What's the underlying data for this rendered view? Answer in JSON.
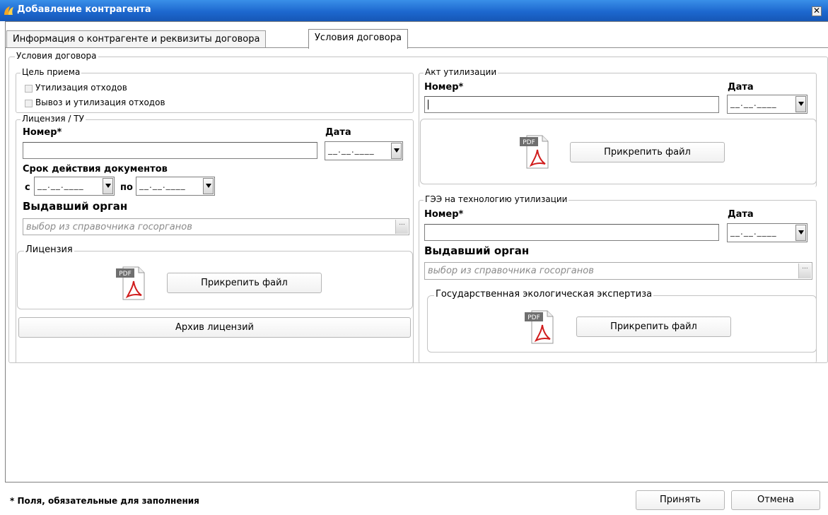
{
  "window": {
    "title": "Добавление контрагента",
    "close_glyph": "✕",
    "icon": "app-logo-icon"
  },
  "tabs": [
    {
      "label": "Информация о контрагенте и реквизиты договора",
      "active": false
    },
    {
      "label": "Условия договора",
      "active": true
    }
  ],
  "conditions": {
    "label": "Условия договора"
  },
  "purpose": {
    "label": "Цель приема",
    "options": [
      {
        "label": "Утилизация отходов",
        "checked": false
      },
      {
        "label": "Вывоз и утилизация отходов",
        "checked": false
      }
    ]
  },
  "license": {
    "label": "Лицензия / ТУ",
    "number_label": "Номер*",
    "number_value": "",
    "date_label": "Дата",
    "date_value": "__.__.____",
    "validity_label": "Срок действия документов",
    "from_label": "с",
    "from_value": "__.__.____",
    "to_label": "по",
    "to_value": "__.__.____",
    "issuer_label": "Выдавший орган",
    "issuer_placeholder": "выбор из справочника госорганов",
    "lookup_glyph": "...",
    "file_group_label": "Лицензия",
    "pdf_text": "PDF",
    "attach_label": "Прикрепить файл",
    "archive_label": "Архив лицензий"
  },
  "act": {
    "label": "Акт утилизации",
    "number_label": "Номер*",
    "number_value": "",
    "date_label": "Дата",
    "date_value": "__.__.____",
    "pdf_text": "PDF",
    "attach_label": "Прикрепить файл"
  },
  "gee": {
    "label": "ГЭЭ на технологию утилизации",
    "number_label": "Номер*",
    "number_value": "",
    "date_label": "Дата",
    "date_value": "__.__.____",
    "issuer_label": "Выдавший орган",
    "issuer_placeholder": "выбор из справочника госорганов",
    "lookup_glyph": "...",
    "file_group_label": "Государственная экологическая экспертиза",
    "pdf_text": "PDF",
    "attach_label": "Прикрепить файл"
  },
  "footer": {
    "required_note": "* Поля, обязательные для заполнения",
    "accept_label": "Принять",
    "cancel_label": "Отмена"
  },
  "colors": {
    "titlebar": "#1d68cf",
    "pdf_red": "#d01c1c"
  }
}
